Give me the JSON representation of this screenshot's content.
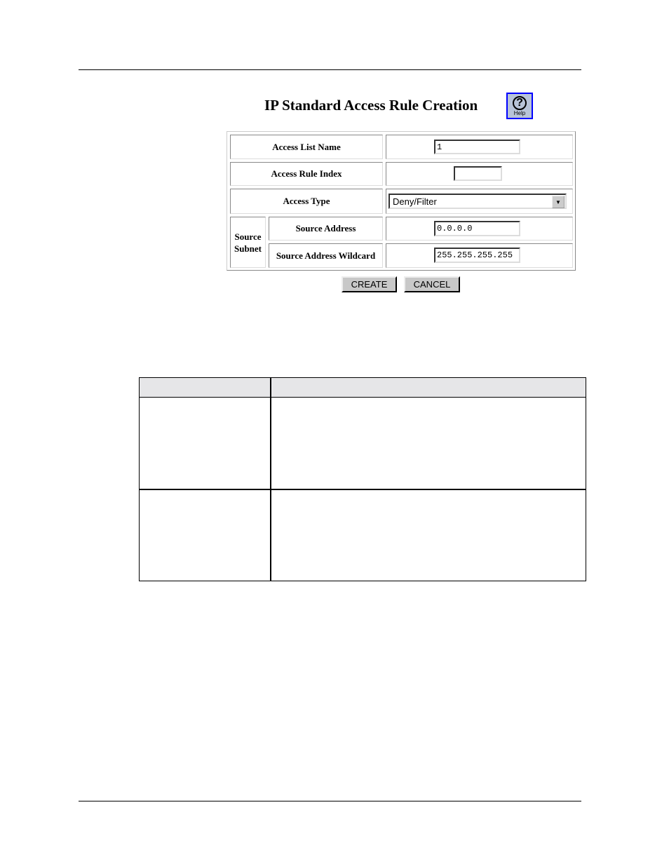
{
  "form": {
    "title": "IP Standard Access Rule Creation",
    "help_label": "Help",
    "rows": [
      {
        "label": "Access List Name",
        "value": "1"
      },
      {
        "label": "Access Rule Index",
        "value": ""
      },
      {
        "label": "Access Type",
        "value": "Deny/Filter"
      },
      {
        "label": "Source Address",
        "value": "0.0.0.0"
      },
      {
        "label": "Source Address Wildcard",
        "value": "255.255.255.255"
      }
    ],
    "group_label": "Source Subnet",
    "create_label": "CREATE",
    "cancel_label": "CANCEL"
  },
  "colors": {
    "help_border": "#0000ff",
    "header_fill": "#e6e6e8"
  }
}
